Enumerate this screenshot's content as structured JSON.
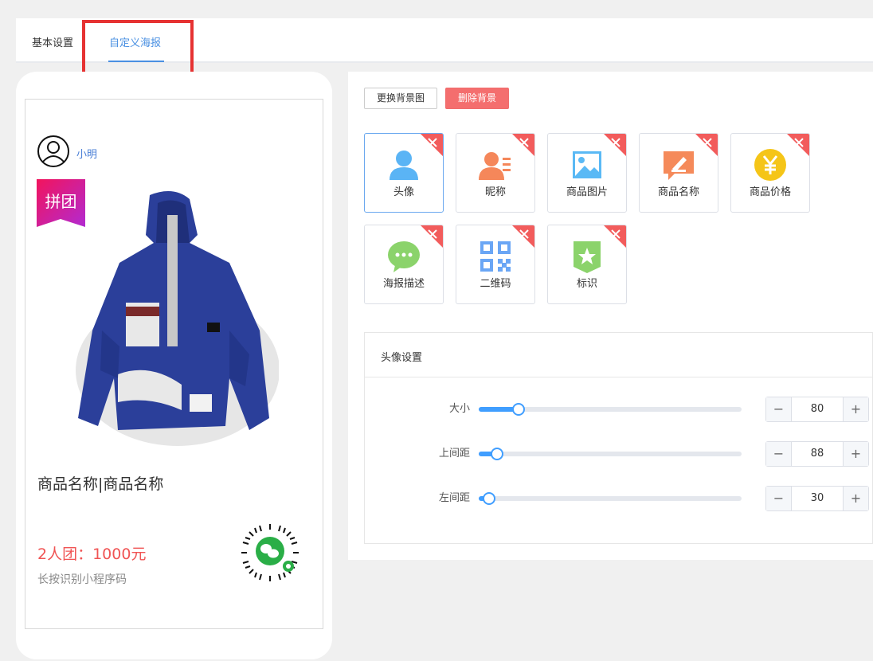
{
  "tabs": [
    {
      "label": "基本设置",
      "active": false
    },
    {
      "label": "自定义海报",
      "active": true
    }
  ],
  "poster": {
    "nickname": "小明",
    "badge": "拼团",
    "product_name": "商品名称|商品名称",
    "price": "2人团：1000元",
    "qr_hint": "长按识别小程序码"
  },
  "toolbar": {
    "change_bg": "更换背景图",
    "delete_bg": "删除背景"
  },
  "components": [
    {
      "label": "头像",
      "icon": "avatar-icon",
      "color": "#5ab4f5",
      "active": true
    },
    {
      "label": "昵称",
      "icon": "nickname-card-icon",
      "color": "#f5875a",
      "active": false
    },
    {
      "label": "商品图片",
      "icon": "image-icon",
      "color": "#5ab9f5",
      "active": false
    },
    {
      "label": "商品名称",
      "icon": "edit-icon",
      "color": "#f58a5a",
      "active": false
    },
    {
      "label": "商品价格",
      "icon": "yen-coin-icon",
      "color": "#f5c518",
      "active": false
    },
    {
      "label": "海报描述",
      "icon": "chat-bubble-icon",
      "color": "#8bd36b",
      "active": false
    },
    {
      "label": "二维码",
      "icon": "qr-code-icon",
      "color": "#6aa6f5",
      "active": false
    },
    {
      "label": "标识",
      "icon": "star-tag-icon",
      "color": "#8bd36b",
      "active": false
    }
  ],
  "settings": {
    "title": "头像设置",
    "rows": [
      {
        "label": "大小",
        "value": "80",
        "fraction": 0.15
      },
      {
        "label": "上间距",
        "value": "88",
        "fraction": 0.07
      },
      {
        "label": "左间距",
        "value": "30",
        "fraction": 0.04
      }
    ]
  },
  "colors": {
    "accent": "#409eff",
    "tab_active": "#4a90e2",
    "danger": "#f46e6e",
    "price": "#f05454",
    "highlight_frame": "#e63232"
  }
}
